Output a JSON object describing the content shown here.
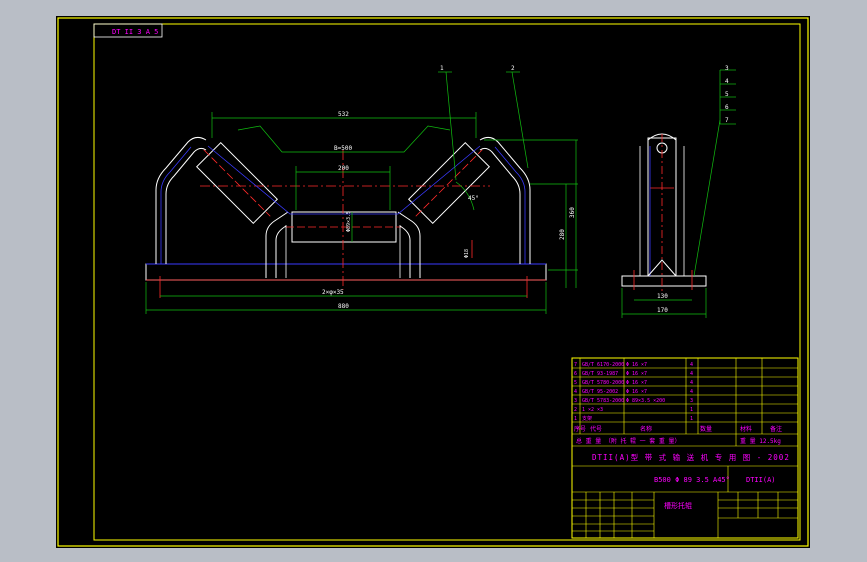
{
  "frame": {
    "drawing_code": "DT II 3 A 5",
    "colors": {
      "background": "#b9bec6",
      "paper": "#000000",
      "border": "#ffff00",
      "outline": "#ffffff",
      "red": "#ff2a2a",
      "blue": "#3a3aff",
      "green": "#10c010",
      "magenta": "#ff00ff",
      "yellow": "#ffff00"
    }
  },
  "front_view": {
    "dims": {
      "top_span": "532",
      "inner_span": "B=500",
      "roller_len": "200",
      "roller_dia": "Φ89×3.5",
      "side_h": "360",
      "roller_h": "280",
      "slot": "Φ18",
      "bolt_span": "2×φ×35",
      "overall": "880",
      "angle": "45°"
    },
    "leaders": [
      "1",
      "2"
    ]
  },
  "side_view": {
    "dims": {
      "inner_w": "130",
      "overall_w": "170"
    },
    "leaders": [
      "3",
      "4",
      "5",
      "6",
      "7"
    ]
  },
  "parts_list": {
    "rows": [
      {
        "name": "GB/T 6170-2000",
        "spec": "Φ 16 ×7",
        "qty": "4",
        "material": "",
        "weight": ""
      },
      {
        "name": "GB/T 93-1987",
        "spec": "Φ 16 ×7",
        "qty": "4",
        "material": "",
        "weight": ""
      },
      {
        "name": "GB/T 5780-2000",
        "spec": "Φ 16 ×7",
        "qty": "4",
        "material": "",
        "weight": ""
      },
      {
        "name": "GB/T 95-2002",
        "spec": "Φ 16 ×7",
        "qty": "4",
        "material": "",
        "weight": ""
      },
      {
        "name": "GB/T 5783-2000",
        "spec": "Φ 89×3.5 ×200",
        "qty": "3",
        "material": "",
        "weight": ""
      },
      {
        "name": "1 ×2 ×3",
        "spec": "",
        "qty": "1",
        "material": "",
        "weight": ""
      },
      {
        "name": "支架",
        "spec": "",
        "qty": "1",
        "material": "",
        "weight": ""
      }
    ],
    "header": {
      "no": "序号",
      "code": "代号",
      "name": "名称",
      "qty": "数量",
      "material": "材料",
      "note": "备注"
    },
    "summary_left": "总 重 量 （附 托 辊 一 套 重 量）",
    "summary_right": "重 量 12.5kg",
    "series_title": "DTII(A)型 带 式 输 送 机 专 用 图 - 2002",
    "model": "B500 Φ 89 3.5 A45°",
    "drawing_no": "DTII(A)",
    "part_name": "槽形托辊"
  }
}
